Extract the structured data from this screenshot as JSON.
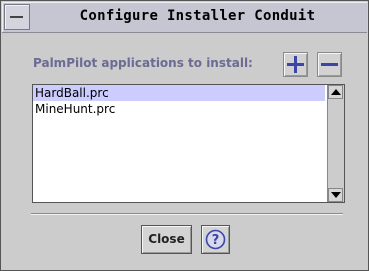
{
  "window": {
    "title": "Configure Installer Conduit"
  },
  "main": {
    "label": "PalmPilot applications to install:",
    "apps": [
      {
        "name": "HardBall.prc",
        "selected": true
      },
      {
        "name": "MineHunt.prc",
        "selected": false
      }
    ]
  },
  "buttons": {
    "close_label": "Close"
  },
  "icons": {
    "add": "plus-icon",
    "remove": "minus-icon",
    "help": "help-question-icon",
    "window_menu": "window-menu-icon"
  },
  "colors": {
    "label": "#6b6b94",
    "selection": "#ccccff",
    "icon": "#3b46a8"
  }
}
